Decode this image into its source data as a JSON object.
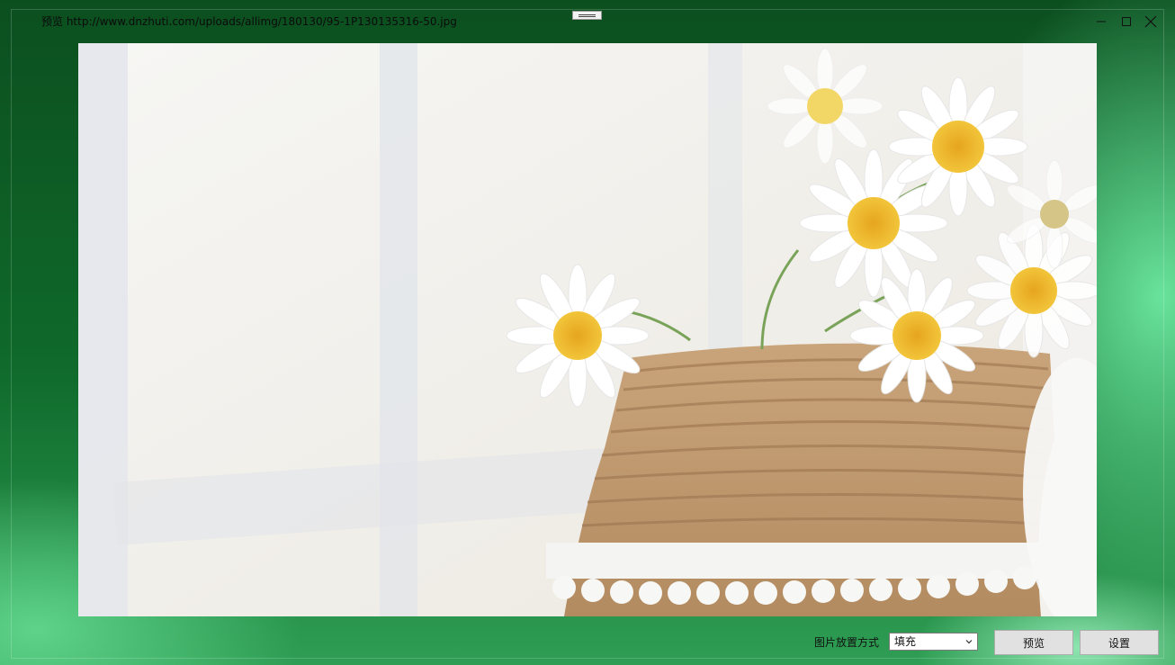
{
  "window": {
    "title": "预览 http://www.dnzhuti.com/uploads/allimg/180130/95-1P130135316-50.jpg",
    "controls": {
      "minimize_icon": "minimize-icon",
      "maximize_icon": "maximize-icon",
      "close_icon": "close-icon"
    }
  },
  "preview_image": {
    "description_icon": "daisies-in-rope-vase-photo"
  },
  "footer": {
    "placement_label": "图片放置方式",
    "placement_select": {
      "value": "填充"
    },
    "preview_button": "预览",
    "settings_button": "设置"
  },
  "colors": {
    "background_green": "#0f6a2b",
    "light_green": "#69e39c",
    "button_face": "#e1e1e1"
  }
}
